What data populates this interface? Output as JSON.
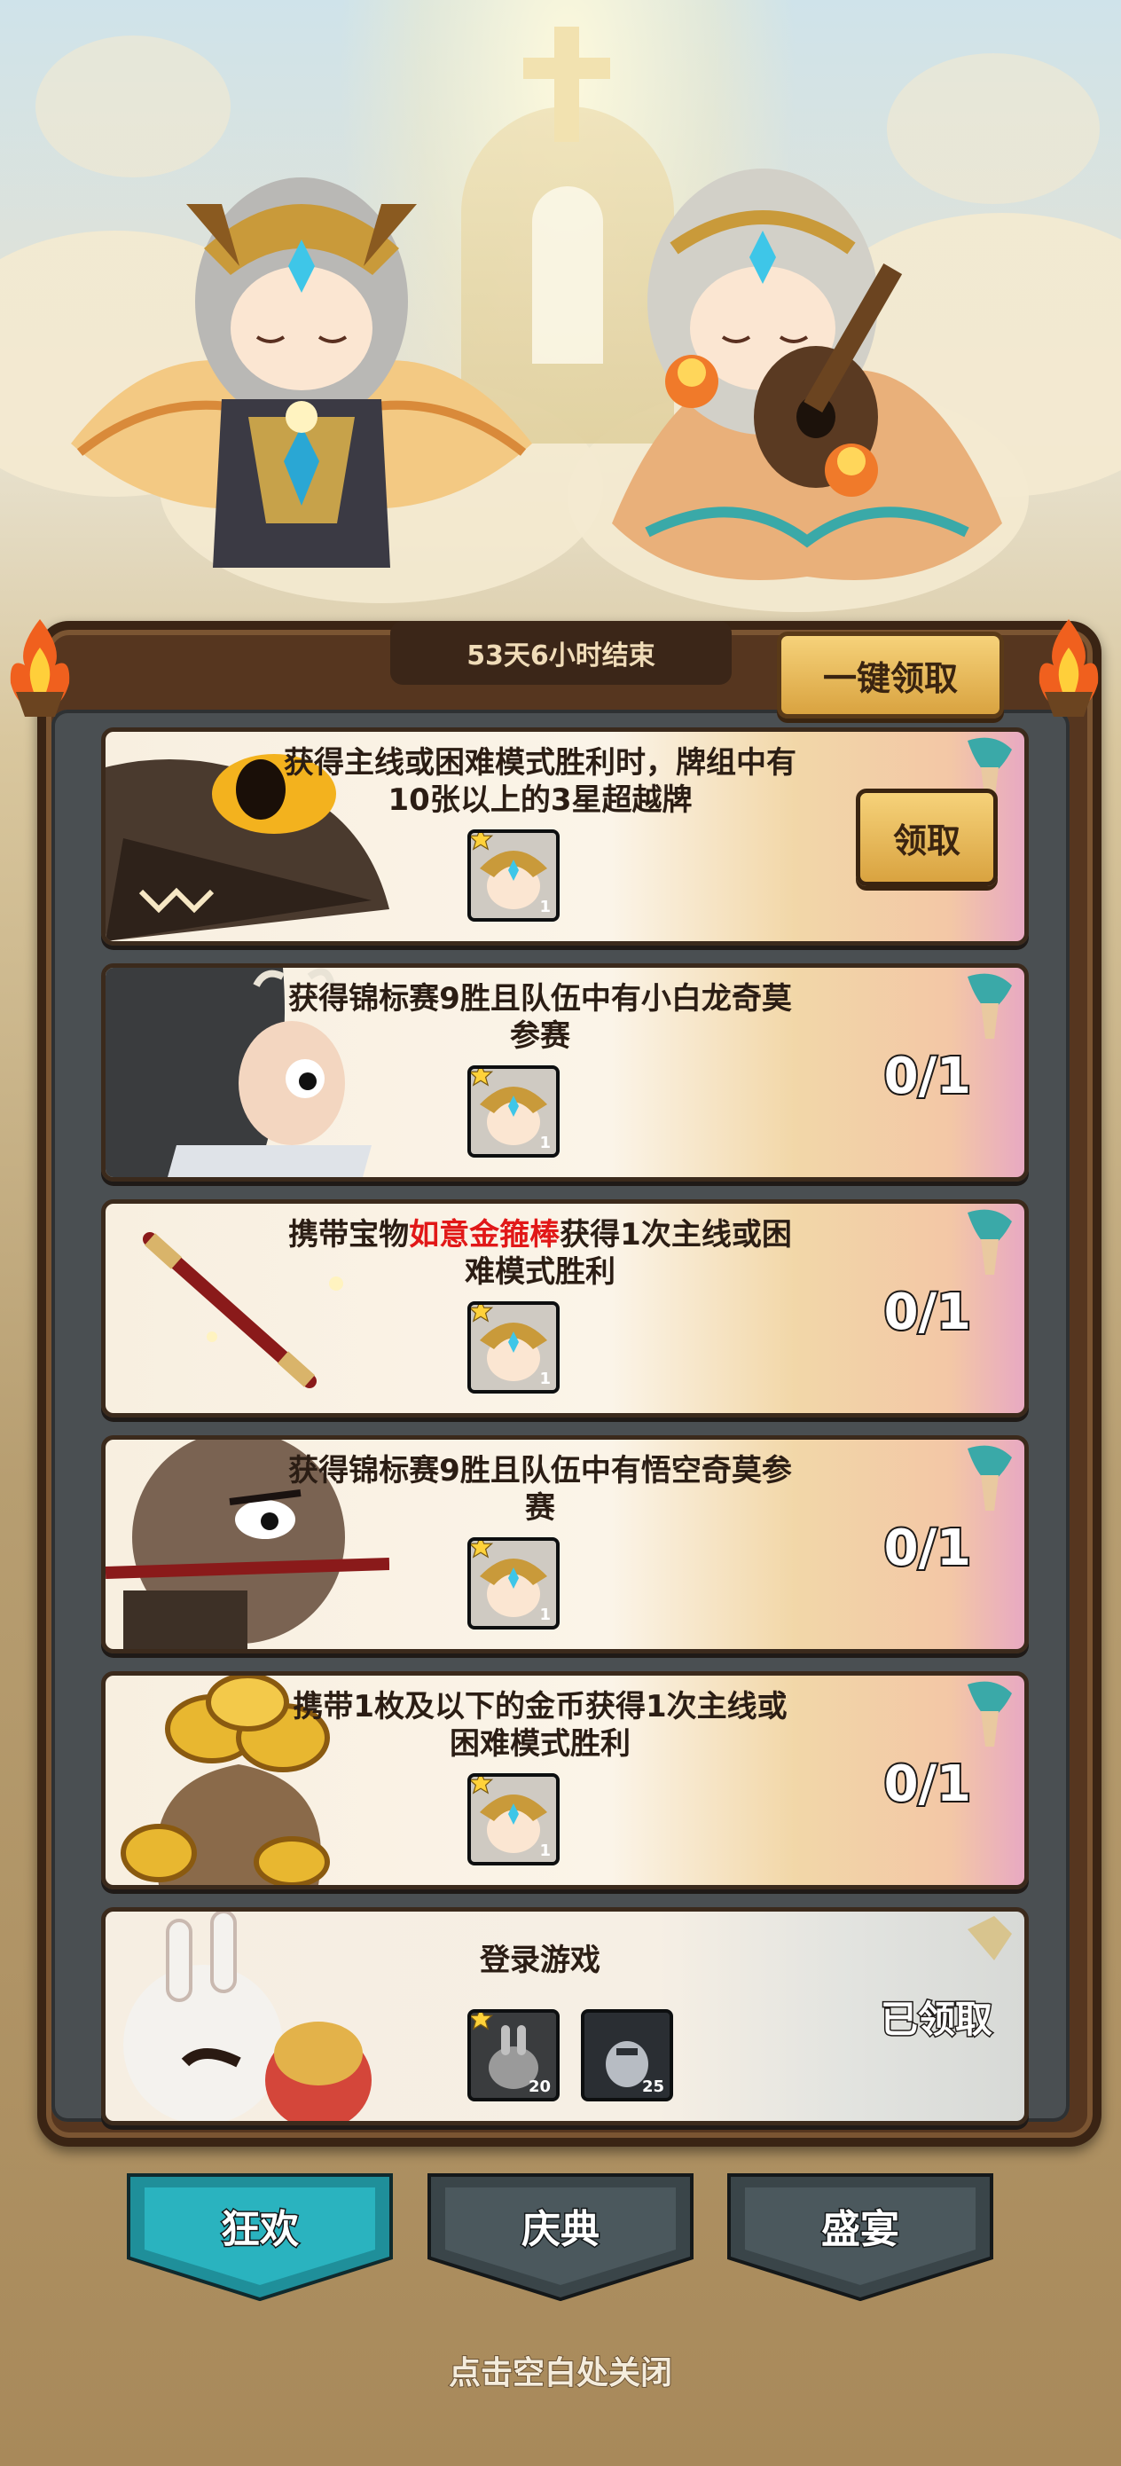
{
  "event": {
    "timer_text": "53天6小时结束",
    "claim_all_label": "一键领取"
  },
  "quests": [
    {
      "title": "获得主线或困难模式胜利时，牌组中有10张以上的3星超越牌",
      "title_parts": [
        "获得主线或困难模式胜利时，牌组中有10张以上的3星超越牌",
        "",
        ""
      ],
      "art": "dragon-head",
      "rewards": [
        {
          "icon": "valkyrie-card",
          "qty": "1"
        }
      ],
      "status": "claimable",
      "button_label": "领取"
    },
    {
      "title": "获得锦标赛9胜且队伍中有小白龙奇莫参赛",
      "title_parts": [
        "获得锦标赛9胜且队伍中有小白龙奇莫参赛",
        "",
        ""
      ],
      "art": "dragon-prince-character",
      "rewards": [
        {
          "icon": "valkyrie-card",
          "qty": "1"
        }
      ],
      "status": "in-progress",
      "progress_text": "0/1"
    },
    {
      "title": "携带宝物如意金箍棒获得1次主线或困难模式胜利",
      "title_parts": [
        "携带宝物",
        "如意金箍棒",
        "获得1次主线或困难模式胜利"
      ],
      "art": "golden-staff",
      "rewards": [
        {
          "icon": "valkyrie-card",
          "qty": "1"
        }
      ],
      "status": "in-progress",
      "progress_text": "0/1"
    },
    {
      "title": "获得锦标赛9胜且队伍中有悟空奇莫参赛",
      "title_parts": [
        "获得锦标赛9胜且队伍中有悟空奇莫参赛",
        "",
        ""
      ],
      "art": "monkey-king-character",
      "rewards": [
        {
          "icon": "valkyrie-card",
          "qty": "1"
        }
      ],
      "status": "in-progress",
      "progress_text": "0/1"
    },
    {
      "title": "携带1枚及以下的金币获得1次主线或困难模式胜利",
      "title_parts": [
        "携带1枚及以下的金币获得1次主线或困难模式胜利",
        "",
        ""
      ],
      "art": "gold-coin-bag",
      "rewards": [
        {
          "icon": "valkyrie-card",
          "qty": "1"
        }
      ],
      "status": "in-progress",
      "progress_text": "0/1"
    },
    {
      "title": "登录游戏",
      "title_parts": [
        "登录游戏",
        "",
        ""
      ],
      "art": "rabbit-and-lion-characters",
      "rewards": [
        {
          "icon": "shadow-rabbit-card",
          "qty": "20"
        },
        {
          "icon": "knight-card",
          "qty": "25"
        }
      ],
      "status": "claimed",
      "claimed_label": "已领取"
    }
  ],
  "tabs": [
    {
      "label": "狂欢",
      "active": true,
      "color": "#1f8f9a"
    },
    {
      "label": "庆典",
      "active": false,
      "color": "#3a4549"
    },
    {
      "label": "盛宴",
      "active": false,
      "color": "#3a4549"
    }
  ],
  "close_hint": "点击空白处关闭",
  "colors": {
    "highlight": "#e11818",
    "panel_wood": "#56361f",
    "button_gold": "#e2b14f"
  }
}
